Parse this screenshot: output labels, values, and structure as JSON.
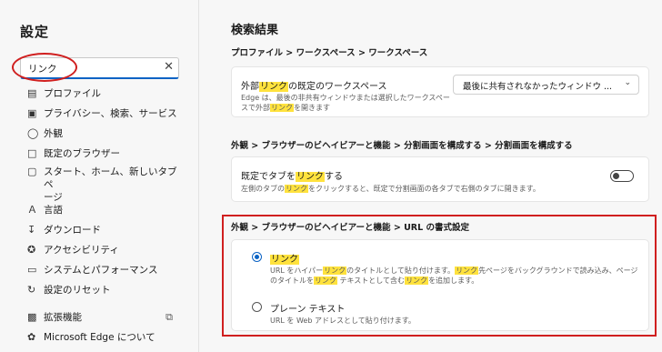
{
  "sidebar": {
    "title": "設定",
    "search_value": "リンク",
    "items": [
      {
        "icon": "profile-icon",
        "label": "プロファイル"
      },
      {
        "icon": "lock-icon",
        "label": "プライバシー、検索、サービス"
      },
      {
        "icon": "palette-icon",
        "label": "外観"
      },
      {
        "icon": "browser-icon",
        "label": "既定のブラウザー"
      },
      {
        "icon": "home-icon",
        "label": "スタート、ホーム、新しいタブ ペ",
        "label_cont": "ージ"
      },
      {
        "icon": "language-icon",
        "label": "言語"
      },
      {
        "icon": "download-icon",
        "label": "ダウンロード"
      },
      {
        "icon": "accessibility-icon",
        "label": "アクセシビリティ"
      },
      {
        "icon": "laptop-icon",
        "label": "システムとパフォーマンス"
      },
      {
        "icon": "reset-icon",
        "label": "設定のリセット"
      },
      {
        "icon": "extensions-icon",
        "label": "拡張機能"
      },
      {
        "icon": "edge-icon",
        "label": "Microsoft Edge について"
      }
    ]
  },
  "main": {
    "heading": "検索結果",
    "section1": {
      "path": "プロファイル > ワークスペース > ワークスペース",
      "title_pre": "外部",
      "title_mark": "リンク",
      "title_post": "の既定のワークスペース",
      "desc_line1": "Edge は、最後の非共有ウィンドウまたは選択したワークスペー",
      "desc_line2_pre": "スで外部",
      "desc_line2_mark": "リンク",
      "desc_line2_post": "を開きます",
      "dropdown_value": "最後に共有されなかったウィンドウ ..."
    },
    "section2": {
      "path": "外観 > ブラウザーのビヘイビアーと機能 > 分割画面を構成する > 分割画面を構成する",
      "title_pre": "既定でタブを",
      "title_mark": "リンク",
      "title_post": "する",
      "desc_pre": "左側のタブの",
      "desc_mark": "リンク",
      "desc_post": "をクリックすると、既定で分割画面の各タブで右側のタブに開きます。",
      "toggle_on": false
    },
    "section3": {
      "path": "外観 > ブラウザーのビヘイビアーと機能 > URL の書式設定",
      "option1": {
        "title": "リンク",
        "selected": true,
        "d1": "URL をハイパー",
        "d2": "リンク",
        "d3": "のタイトルとして貼り付けます。",
        "d4": "リンク",
        "d5": "先ページをバックグラウンドで読み込み、ページ",
        "d6": "のタイトルを",
        "d7": "リンク",
        "d8": " テキストとして含む",
        "d9": "リンク",
        "d10": "を追加します。"
      },
      "option2": {
        "title": "プレーン テキスト",
        "selected": false,
        "desc": "URL を Web アドレスとして貼り付けます。"
      }
    }
  },
  "colors": {
    "accent": "#0b63c4",
    "highlight": "#ffe23d",
    "annotation": "#d01f1f"
  }
}
